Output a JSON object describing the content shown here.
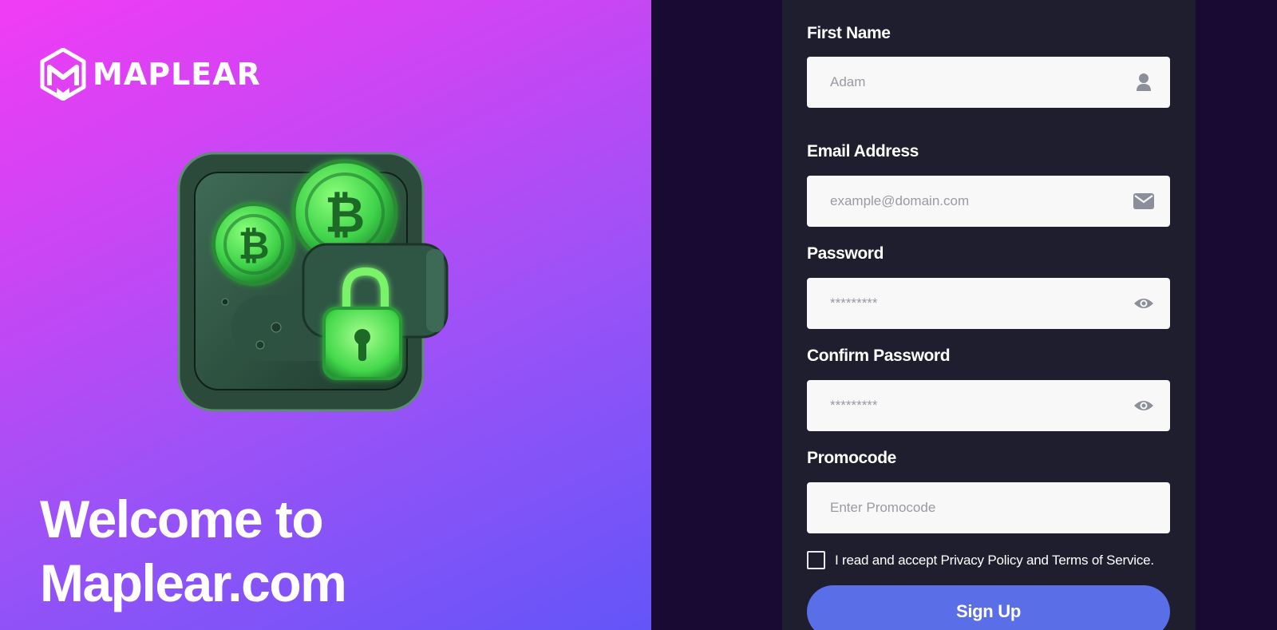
{
  "brand": {
    "name": "MAPLEAR"
  },
  "hero": {
    "welcome_line1": "Welcome to",
    "welcome_line2": "Maplear.com"
  },
  "form": {
    "first_name": {
      "label": "First Name",
      "placeholder": "Adam",
      "icon": "user-icon"
    },
    "email": {
      "label": "Email Address",
      "placeholder": "example@domain.com",
      "icon": "envelope-icon"
    },
    "password": {
      "label": "Password",
      "placeholder": "*********",
      "icon": "eye-icon"
    },
    "confirm_password": {
      "label": "Confirm Password",
      "placeholder": "*********",
      "icon": "eye-icon"
    },
    "promocode": {
      "label": "Promocode",
      "placeholder": "Enter Promocode"
    },
    "terms": {
      "prefix": "I read and accept ",
      "privacy_link": "Privacy Policy",
      "middle": " and ",
      "terms_link": "Terms of Service",
      "suffix": ".",
      "checked": false
    },
    "submit_label": "Sign Up"
  },
  "colors": {
    "gradient_start": "#f13cf5",
    "gradient_end": "#6355f8",
    "page_bg": "#180a33",
    "panel_bg": "#1e1e2e",
    "button": "#5a6ee8",
    "icon_grey": "#8a8f9a",
    "neon_green": "#56e35a"
  }
}
